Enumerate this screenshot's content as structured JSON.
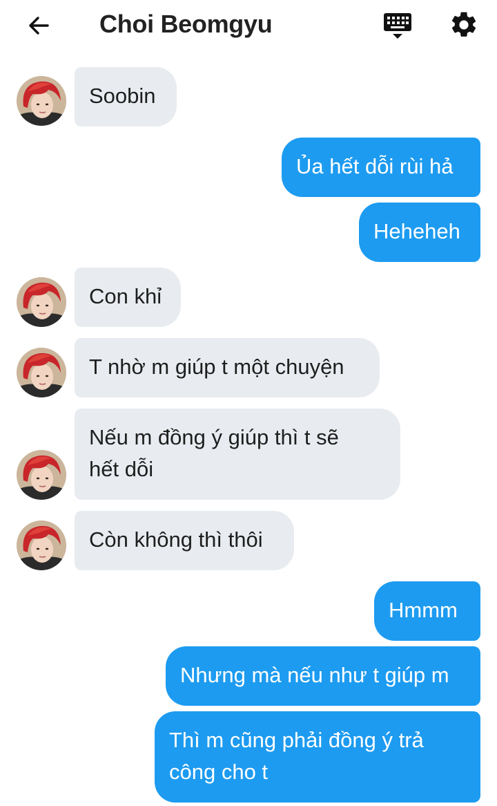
{
  "header": {
    "title": "Choi Beomgyu"
  },
  "messages": [
    {
      "dir": "in",
      "text": "Soobin"
    },
    {
      "dir": "out",
      "text": "Ủa hết dỗi rùi hả"
    },
    {
      "dir": "out",
      "text": "Heheheh"
    },
    {
      "dir": "in",
      "text": "Con khỉ"
    },
    {
      "dir": "in",
      "text": "T nhờ m giúp t một chuyện"
    },
    {
      "dir": "in",
      "lines": [
        "Nếu m đồng ý giúp thì t sẽ",
        "hết dỗi"
      ]
    },
    {
      "dir": "in",
      "text": "Còn không thì thôi"
    },
    {
      "dir": "out",
      "text": "Hmmm"
    },
    {
      "dir": "out",
      "text": "Nhưng mà nếu như t giúp m"
    },
    {
      "dir": "out",
      "lines": [
        "Thì m cũng phải đồng ý trả",
        "công cho t"
      ]
    }
  ]
}
